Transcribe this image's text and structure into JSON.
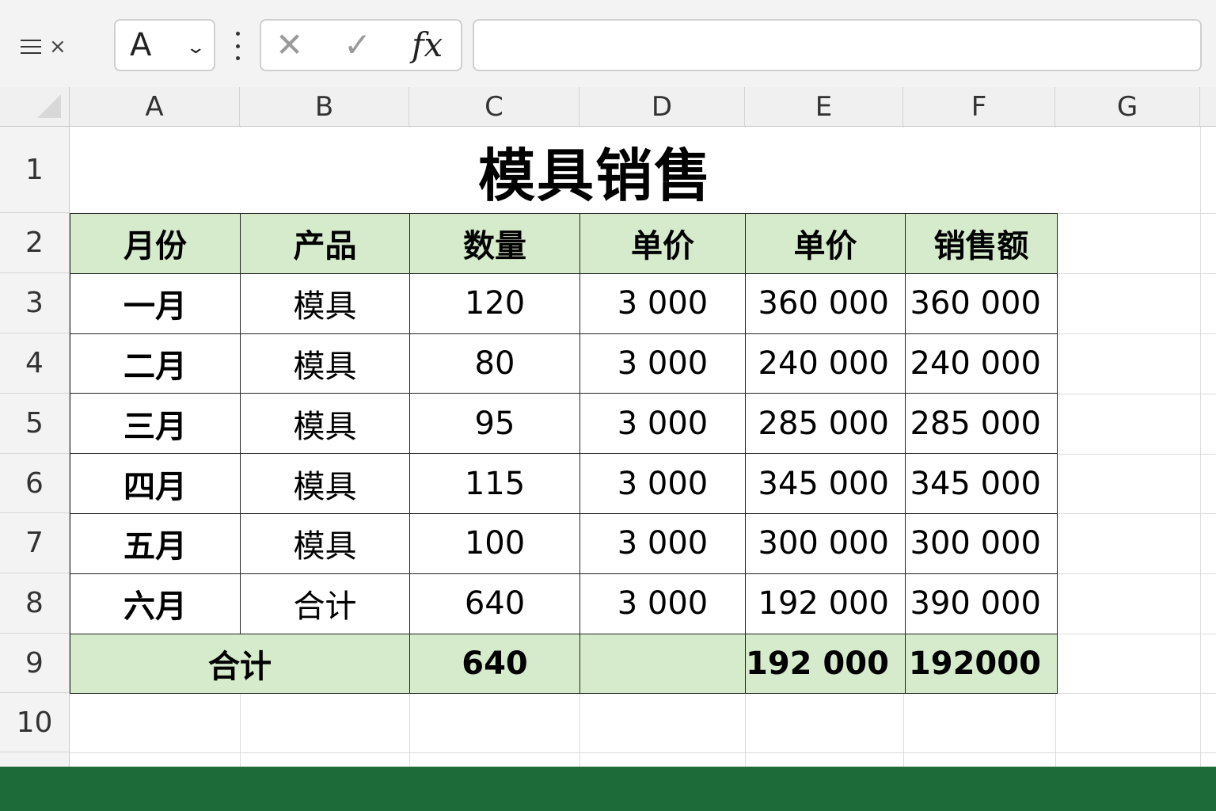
{
  "toolbar": {
    "namebox_value": "A",
    "formula_value": ""
  },
  "columns": [
    "A",
    "B",
    "C",
    "D",
    "E",
    "F",
    "G"
  ],
  "rows": [
    "1",
    "2",
    "3",
    "4",
    "5",
    "6",
    "7",
    "8",
    "9",
    "10"
  ],
  "sheet": {
    "title": "模具销售",
    "headers": [
      "月份",
      "产品",
      "数量",
      "单价",
      "单价",
      "销售额"
    ],
    "data_rows": [
      [
        "一月",
        "模具",
        "120",
        "3 000",
        "360 000",
        "360 000"
      ],
      [
        "二月",
        "模具",
        "80",
        "3 000",
        "240 000",
        "240 000"
      ],
      [
        "三月",
        "模具",
        "95",
        "3 000",
        "285 000",
        "285 000"
      ],
      [
        "四月",
        "模具",
        "115",
        "3 000",
        "345 000",
        "345 000"
      ],
      [
        "五月",
        "模具",
        "100",
        "3 000",
        "300 000",
        "300 000"
      ],
      [
        "六月",
        "合计",
        "640",
        "3 000",
        "192 000",
        "390 000"
      ]
    ],
    "total_row": {
      "label": "合计",
      "quantity": "640",
      "unit_price": "",
      "amount_e": "192 000",
      "amount_f": "192000"
    }
  },
  "colors": {
    "header_fill": "#d5ebcc",
    "accent_bar": "#1e6b3a"
  }
}
